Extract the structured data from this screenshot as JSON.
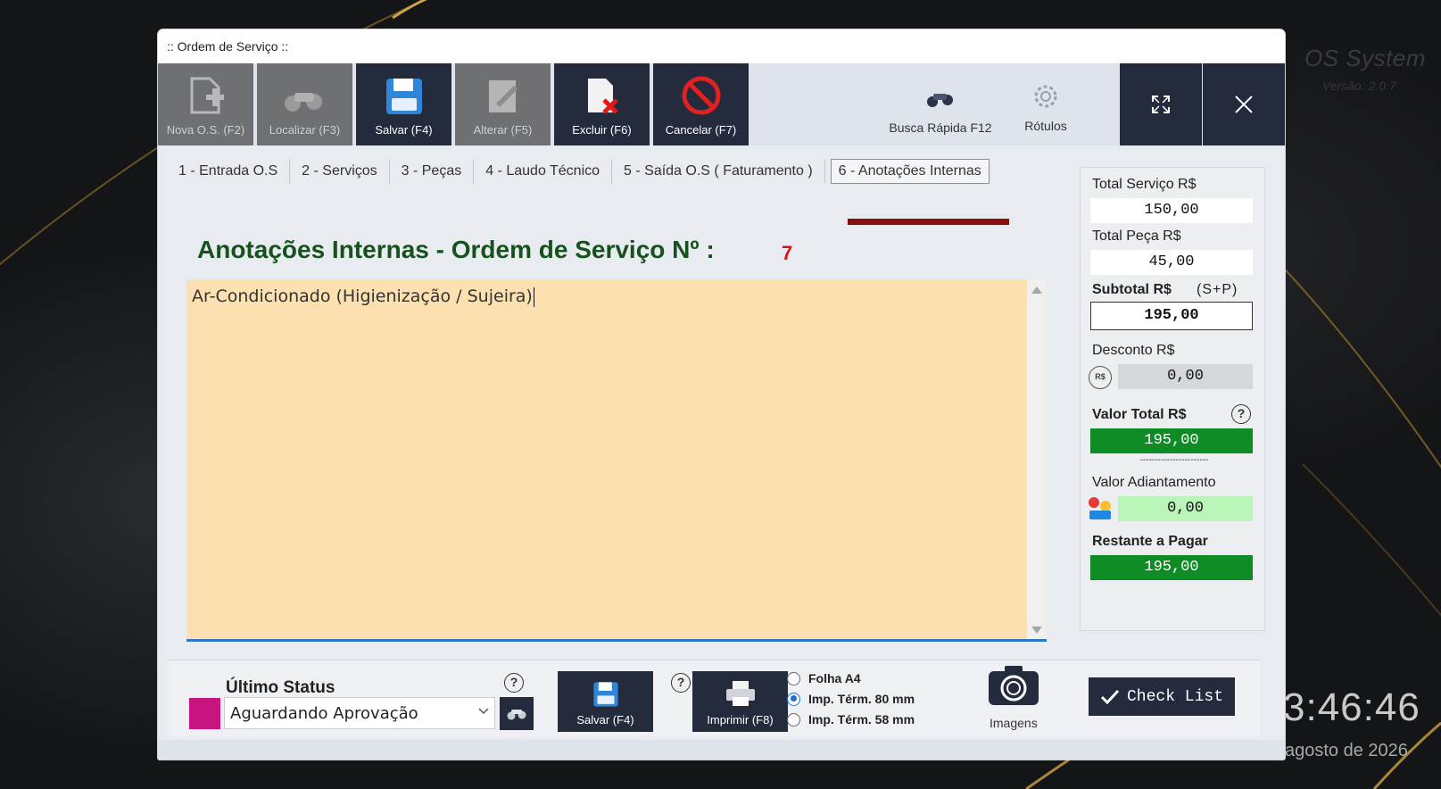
{
  "window": {
    "title": ":: Ordem de Serviço ::"
  },
  "desktop": {
    "brand_title": "OS System",
    "brand_version": "Versão: 2.0.7",
    "clock": "3:46:46",
    "date": "agosto de 2026"
  },
  "toolbar": {
    "nova": "Nova O.S. (F2)",
    "localizar": "Localizar (F3)",
    "salvar": "Salvar (F4)",
    "alterar": "Alterar  (F5)",
    "excluir": "Excluir (F6)",
    "cancelar": "Cancelar (F7)",
    "busca_rapida": "Busca Rápida F12",
    "rotulos": "Rótulos"
  },
  "tabs": [
    {
      "label": "1 - Entrada O.S"
    },
    {
      "label": "2 - Serviços"
    },
    {
      "label": "3 - Peças"
    },
    {
      "label": "4 - Laudo Técnico"
    },
    {
      "label": "5 - Saída O.S ( Faturamento )"
    },
    {
      "label": "6 - Anotações Internas"
    }
  ],
  "main": {
    "heading": "Anotações Internas - Ordem de Serviço Nº :",
    "os_number": "7",
    "notes_text": "Ar-Condicionado (Higienização / Sujeira)"
  },
  "totals": {
    "total_servico_label": "Total Serviço R$",
    "total_servico": "150,00",
    "total_peca_label": "Total Peça R$",
    "total_peca": "45,00",
    "subtotal_label": "Subtotal R$",
    "subtotal_hint": "(S+P)",
    "subtotal": "195,00",
    "desconto_label": "Desconto R$",
    "desconto_icon_text": "R$",
    "desconto": "0,00",
    "valor_total_label": "Valor Total R$",
    "valor_total": "195,00",
    "separator": "-----------------------",
    "adiantamento_label": "Valor Adiantamento",
    "adiantamento": "0,00",
    "restante_label": "Restante a Pagar",
    "restante": "195,00",
    "help": "?"
  },
  "bottom": {
    "status_label": "Último Status",
    "status_value": "Aguardando Aprovação",
    "help": "?",
    "salvar": "Salvar (F4)",
    "imprimir": "Imprimir (F8)",
    "print_options": [
      {
        "label": "Folha A4",
        "selected": false
      },
      {
        "label": "Imp. Térm. 80 mm",
        "selected": true
      },
      {
        "label": "Imp. Térm. 58 mm",
        "selected": false
      }
    ],
    "imagens": "Imagens",
    "check_list": "Check List"
  },
  "colors": {
    "toolbar_dark": "#242b3c",
    "heading_green": "#17521e",
    "os_number_red": "#d11717",
    "notes_bg": "#fde0b0",
    "total_green": "#0e8b24",
    "advance_green": "#b9f5b9",
    "status_color": "#c7147f",
    "tab_underline": "#8b0e0e"
  }
}
